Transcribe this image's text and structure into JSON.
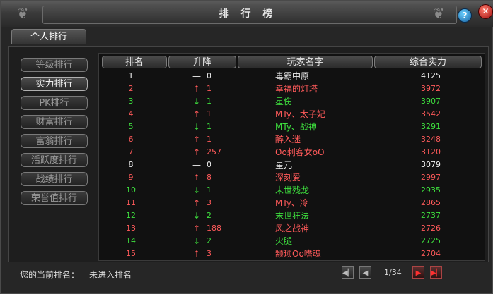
{
  "window": {
    "title": "排 行 榜",
    "help": "?",
    "close": "✕"
  },
  "tabs": [
    {
      "label": "个人排行"
    }
  ],
  "sidebar": [
    {
      "label": "等级排行",
      "active": false
    },
    {
      "label": "实力排行",
      "active": true
    },
    {
      "label": "PK排行",
      "active": false
    },
    {
      "label": "财富排行",
      "active": false
    },
    {
      "label": "富翁排行",
      "active": false
    },
    {
      "label": "活跃度排行",
      "active": false
    },
    {
      "label": "战绩排行",
      "active": false
    },
    {
      "label": "荣誉值排行",
      "active": false
    }
  ],
  "table": {
    "headers": {
      "rank": "排名",
      "change": "升降",
      "name": "玩家名字",
      "power": "综合实力"
    },
    "rows": [
      {
        "rank": "1",
        "dir": "same",
        "change": "0",
        "name": "毒霸中原",
        "power": "4125"
      },
      {
        "rank": "2",
        "dir": "up",
        "change": "1",
        "name": "幸福的灯塔",
        "power": "3972"
      },
      {
        "rank": "3",
        "dir": "down",
        "change": "1",
        "name": "星伤",
        "power": "3907"
      },
      {
        "rank": "4",
        "dir": "up",
        "change": "1",
        "name": "MTy、太子妃",
        "power": "3542"
      },
      {
        "rank": "5",
        "dir": "down",
        "change": "1",
        "name": "MTy、战神",
        "power": "3291"
      },
      {
        "rank": "6",
        "dir": "up",
        "change": "1",
        "name": "醉入迷",
        "power": "3248"
      },
      {
        "rank": "7",
        "dir": "up",
        "change": "257",
        "name": "Oo刺客女oO",
        "power": "3120"
      },
      {
        "rank": "8",
        "dir": "same",
        "change": "0",
        "name": "星元",
        "power": "3079"
      },
      {
        "rank": "9",
        "dir": "up",
        "change": "8",
        "name": "深刻爱",
        "power": "2997"
      },
      {
        "rank": "10",
        "dir": "down",
        "change": "1",
        "name": "末世残龙",
        "power": "2935"
      },
      {
        "rank": "11",
        "dir": "up",
        "change": "3",
        "name": "MTy、冷",
        "power": "2865"
      },
      {
        "rank": "12",
        "dir": "down",
        "change": "2",
        "name": "末世狂法",
        "power": "2737"
      },
      {
        "rank": "13",
        "dir": "up",
        "change": "188",
        "name": "风之战神",
        "power": "2726"
      },
      {
        "rank": "14",
        "dir": "down",
        "change": "2",
        "name": "火腿",
        "power": "2725"
      },
      {
        "rank": "15",
        "dir": "up",
        "change": "3",
        "name": "颛顼Oo嗜魂",
        "power": "2704"
      }
    ]
  },
  "arrows": {
    "up": "↑",
    "down": "↓",
    "same": "—"
  },
  "colors": {
    "up": "#ff5a5a",
    "down": "#3ee03e",
    "same": "#f0f0f0"
  },
  "footer": {
    "label": "您的当前排名：",
    "value": "未进入排名",
    "page": "1/34",
    "first": "◀▏",
    "prev": "◀",
    "next": "▶",
    "last": "▶▏"
  }
}
